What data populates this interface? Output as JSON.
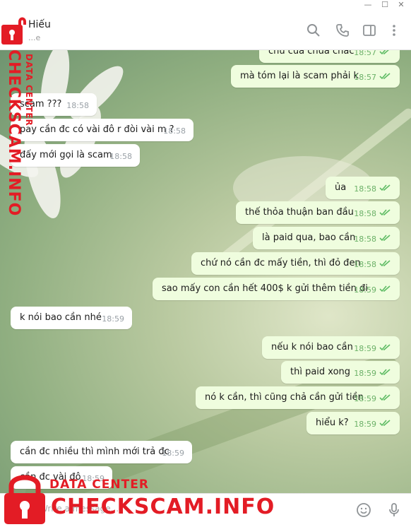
{
  "window": {
    "min": "—",
    "max": "☐",
    "close": "✕"
  },
  "header": {
    "title": "Hiếu",
    "status": "...e"
  },
  "icons": {
    "search": "search-icon",
    "call": "phone-icon",
    "sidebar": "sidebar-toggle-icon",
    "more": "more-vertical-icon"
  },
  "messages": [
    {
      "dir": "out",
      "text": "chứ của chưa chắc",
      "time": "18:57"
    },
    {
      "dir": "out",
      "text": "mà tóm lại là scam phải k",
      "time": "18:57"
    },
    {
      "dir": "in",
      "text": "scam  ???",
      "time": "18:58"
    },
    {
      "dir": "in",
      "text": "pay cần đc có vài đô r đòi vài m ?",
      "time": "18:58"
    },
    {
      "dir": "in",
      "text": "đấy mới gọi là scam",
      "time": "18:58"
    },
    {
      "dir": "out",
      "text": "ủa",
      "time": "18:58"
    },
    {
      "dir": "out",
      "text": "thế thỏa thuận ban đầu",
      "time": "18:58"
    },
    {
      "dir": "out",
      "text": "là paid qua, bao cần",
      "time": "18:58"
    },
    {
      "dir": "out",
      "text": "chứ nó cần đc mấy tiền, thì đỏ đen",
      "time": "18:58"
    },
    {
      "dir": "out",
      "text": "sao mấy con cần hết 400$ k gửi thêm tiền đi",
      "time": "18:59"
    },
    {
      "dir": "in",
      "text": "k nói bao cần nhé",
      "time": "18:59"
    },
    {
      "dir": "out",
      "text": "nếu k nói bao cần",
      "time": "18:59"
    },
    {
      "dir": "out",
      "text": "thì paid xong",
      "time": "18:59"
    },
    {
      "dir": "out",
      "text": "nó k cần, thì cũng chả cần gửi tiền",
      "time": "18:59"
    },
    {
      "dir": "out",
      "text": "hiểu k?",
      "time": "18:59"
    },
    {
      "dir": "in",
      "text": "cần đc nhiều thì mình mới trả đc",
      "time": "18:59"
    },
    {
      "dir": "in",
      "text": "cần đc vài đô",
      "time": "18:59"
    }
  ],
  "input": {
    "placeholder": "Write a message..."
  },
  "watermark": {
    "vertical_big": "CHECKSCAM.INFO",
    "vertical_small": "DATA CENTER",
    "bottom_small": "DATA CENTER",
    "bottom_big": "CHECKSCAM.INFO"
  }
}
